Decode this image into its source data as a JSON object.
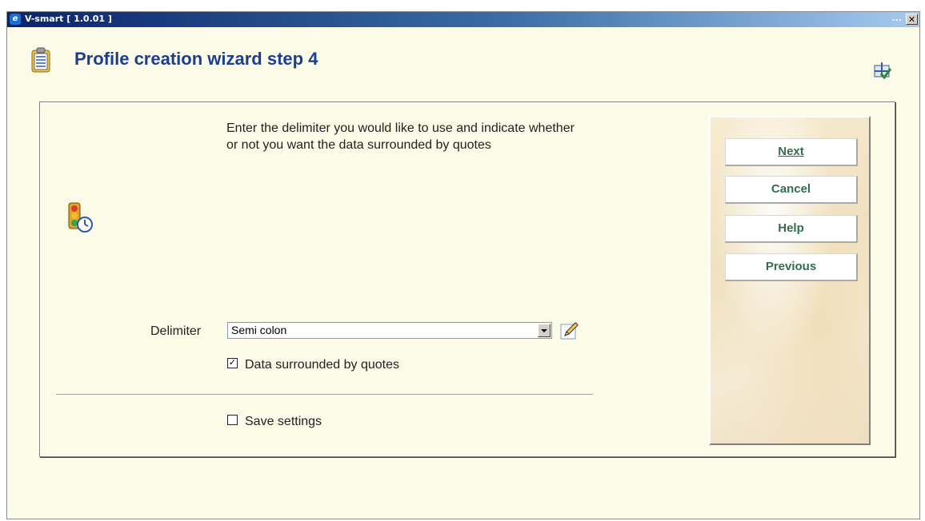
{
  "window": {
    "title": "V-smart [ 1.0.01 ]",
    "minimize_label": "...",
    "close_label": "✕"
  },
  "header": {
    "title": "Profile creation wizard step 4"
  },
  "form": {
    "instruction": "Enter the delimiter you would like to use and indicate whether or not you want the data surrounded by quotes",
    "delimiter_label": "Delimiter",
    "delimiter_value": "Semi colon",
    "quotes_label": "Data surrounded by quotes",
    "quotes_checked": true,
    "quotes_mark": "✓",
    "save_label": "Save settings",
    "save_checked": false
  },
  "buttons": {
    "next": "Next",
    "cancel": "Cancel",
    "help": "Help",
    "previous": "Previous"
  },
  "icons": {
    "app": "ie-icon",
    "header": "clipboard-icon",
    "wizard": "wizard-check-icon",
    "traffic": "traffic-light-clock-icon",
    "edit": "pencil-icon"
  },
  "colors": {
    "title": "#1b3f8f",
    "button_text": "#2f6f4f",
    "background": "#fbfbe8"
  }
}
